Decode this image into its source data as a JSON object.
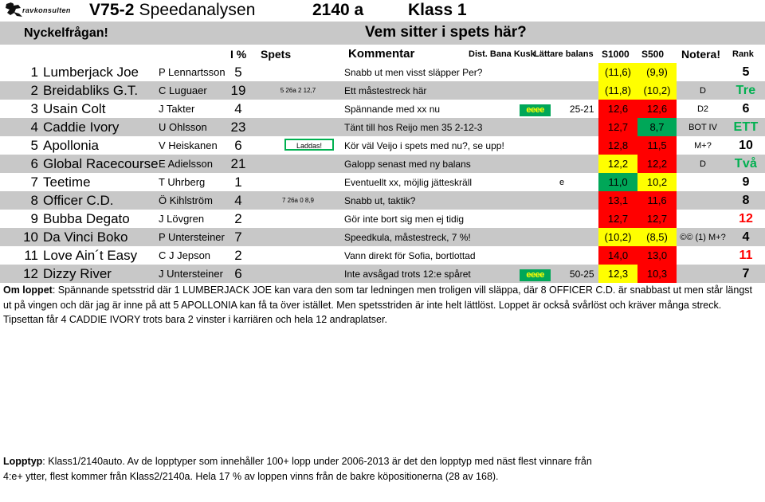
{
  "header": {
    "logo_text": "ravkonsulten",
    "race_label": "V75-2",
    "analysis_title": "Speedanalysen",
    "distance": "2140 a",
    "race_class": "Klass 1"
  },
  "key_question": {
    "left_label": "Nyckelfrågan!",
    "question": "Vem sitter i spets här?"
  },
  "columns": {
    "i_percent": "I %",
    "spets": "Spets",
    "kommentar": "Kommentar",
    "dist_bana_kusk": "Dist. Bana Kusk",
    "lattare_balans": "Lättare balans",
    "s1000": "S1000",
    "s500": "S500",
    "notera": "Notera!",
    "rank": "Rank"
  },
  "rows": [
    {
      "num": "1",
      "horse": "Lumberjack Joe",
      "driver": "P Lennartsson",
      "i_percent": "5",
      "spets": "",
      "spets_boxed": false,
      "kommentar": "Snabb ut men visst släpper Per?",
      "dist": "",
      "lattare_box": "",
      "lattare_range": "",
      "s1000": "(11,6)",
      "s1000_color": "yellow",
      "s500": "(9,9)",
      "s500_color": "yellow",
      "notera": "",
      "rank": "5",
      "rank_style": "black",
      "shaded": false
    },
    {
      "num": "2",
      "horse": "Breidabliks G.T.",
      "driver": "C Luguaer",
      "i_percent": "19",
      "spets": "5 26a 2 12,7",
      "spets_boxed": false,
      "kommentar": "Ett måstestreck här",
      "dist": "",
      "lattare_box": "",
      "lattare_range": "",
      "s1000": "(11,8)",
      "s1000_color": "yellow",
      "s500": "(10,2)",
      "s500_color": "yellow",
      "notera": "D",
      "rank": "Tre",
      "rank_style": "word",
      "shaded": true
    },
    {
      "num": "3",
      "horse": "Usain Colt",
      "driver": "J Takter",
      "i_percent": "4",
      "spets": "",
      "spets_boxed": false,
      "kommentar": "Spännande med xx nu",
      "dist": "",
      "lattare_box": "eeee",
      "lattare_range": "25-21",
      "s1000": "12,6",
      "s1000_color": "red",
      "s500": "12,6",
      "s500_color": "red",
      "notera": "D2",
      "rank": "6",
      "rank_style": "black",
      "shaded": false
    },
    {
      "num": "4",
      "horse": "Caddie Ivory",
      "driver": "U Ohlsson",
      "i_percent": "23",
      "spets": "",
      "spets_boxed": false,
      "kommentar": "Tänt till hos Reijo men 35 2-12-3",
      "dist": "",
      "lattare_box": "",
      "lattare_range": "",
      "s1000": "12,7",
      "s1000_color": "red",
      "s500": "8,7",
      "s500_color": "green",
      "notera": "BOT IV",
      "rank": "ETT",
      "rank_style": "word",
      "shaded": true
    },
    {
      "num": "5",
      "horse": "Apollonia",
      "driver": "V Heiskanen",
      "i_percent": "6",
      "spets": "Laddas!",
      "spets_boxed": true,
      "kommentar": "Kör väl Veijo i spets med nu?, se upp!",
      "dist": "",
      "lattare_box": "",
      "lattare_range": "",
      "s1000": "12,8",
      "s1000_color": "red",
      "s500": "11,5",
      "s500_color": "red",
      "notera": "M+?",
      "rank": "10",
      "rank_style": "black",
      "shaded": false
    },
    {
      "num": "6",
      "horse": "Global Racecourse",
      "driver": "E Adielsson",
      "i_percent": "21",
      "spets": "",
      "spets_boxed": false,
      "kommentar": "Galopp senast med ny balans",
      "dist": "",
      "lattare_box": "",
      "lattare_range": "",
      "s1000": "12,2",
      "s1000_color": "yellow",
      "s500": "12,2",
      "s500_color": "red",
      "notera": "D",
      "rank": "Två",
      "rank_style": "word",
      "shaded": true
    },
    {
      "num": "7",
      "horse": "Teetime",
      "driver": "T Uhrberg",
      "i_percent": "1",
      "spets": "",
      "spets_boxed": false,
      "kommentar": "Eventuellt xx, möjlig jätteskräll",
      "dist": "",
      "lattare_box": "",
      "lattare_range": "",
      "lattare_plain": "e",
      "s1000": "11,0",
      "s1000_color": "green",
      "s500": "10,2",
      "s500_color": "yellow",
      "notera": "",
      "rank": "9",
      "rank_style": "black",
      "shaded": false
    },
    {
      "num": "8",
      "horse": "Officer C.D.",
      "driver": "Ö Kihlström",
      "i_percent": "4",
      "spets": "7 26a 0 8,9",
      "spets_boxed": false,
      "kommentar": "Snabb ut, taktik?",
      "dist": "",
      "lattare_box": "",
      "lattare_range": "",
      "s1000": "13,1",
      "s1000_color": "red",
      "s500": "11,6",
      "s500_color": "red",
      "notera": "",
      "rank": "8",
      "rank_style": "black",
      "shaded": true
    },
    {
      "num": "9",
      "horse": "Bubba Degato",
      "driver": "J Lövgren",
      "i_percent": "2",
      "spets": "",
      "spets_boxed": false,
      "kommentar": "Gör inte bort sig men ej tidig",
      "dist": "",
      "lattare_box": "",
      "lattare_range": "",
      "s1000": "12,7",
      "s1000_color": "red",
      "s500": "12,7",
      "s500_color": "red",
      "notera": "",
      "rank": "12",
      "rank_style": "red",
      "shaded": false
    },
    {
      "num": "10",
      "horse": "Da Vinci Boko",
      "driver": "P Untersteiner",
      "i_percent": "7",
      "spets": "",
      "spets_boxed": false,
      "kommentar": "Speedkula, måstestreck, 7 %!",
      "dist": "",
      "lattare_box": "",
      "lattare_range": "",
      "s1000": "(10,2)",
      "s1000_color": "yellow",
      "s500": "(8,5)",
      "s500_color": "yellow",
      "notera": "©© (1) M+?",
      "rank": "4",
      "rank_style": "black",
      "shaded": true
    },
    {
      "num": "11",
      "horse": "Love Ain´t Easy",
      "driver": "C J Jepson",
      "i_percent": "2",
      "spets": "",
      "spets_boxed": false,
      "kommentar": "Vann direkt för Sofia, bortlottad",
      "dist": "",
      "lattare_box": "",
      "lattare_range": "",
      "s1000": "14,0",
      "s1000_color": "red",
      "s500": "13,0",
      "s500_color": "red",
      "notera": "",
      "rank": "11",
      "rank_style": "red",
      "shaded": false
    },
    {
      "num": "12",
      "horse": "Dizzy River",
      "driver": "J Untersteiner",
      "i_percent": "6",
      "spets": "",
      "spets_boxed": false,
      "kommentar": "Inte avsågad trots 12:e spåret",
      "dist": "",
      "lattare_box": "eeee",
      "lattare_range": "50-25",
      "s1000": "12,3",
      "s1000_color": "yellow",
      "s500": "10,3",
      "s500_color": "red",
      "notera": "",
      "rank": "7",
      "rank_style": "black",
      "shaded": true
    }
  ],
  "footer": {
    "om_loppet_label": "Om loppet",
    "om_loppet_text": ": Spännande spetsstrid där 1 LUMBERJACK JOE kan vara den som tar ledningen men troligen vill släppa, där 8 OFFICER C.D. är snabbast ut men står längst ut på vingen och där jag är inne på att 5 APOLLONIA kan få ta över istället. Men spetsstriden är inte helt lättlöst. Loppet är också svårlöst och kräver många streck. Tipsettan får 4 CADDIE IVORY trots bara 2 vinster i karriären och hela 12 andraplatser.",
    "lopptyp_label": "Lopptyp",
    "lopptyp_text": ": Klass1/2140auto. Av de lopptyper som innehåller 100+ lopp under 2006-2013 är det den lopptyp med näst flest vinnare från 4:e+ ytter, flest kommer från Klass2/2140a. Hela 17 % av loppen vinns från de bakre köpositionerna (28 av 168)."
  },
  "colors": {
    "red": "#ff0000",
    "yellow": "#ffff00",
    "green": "#00a758",
    "rank_green": "#00b050",
    "band_gray": "#c8c8c8",
    "row_gray": "#c8c8c8"
  }
}
